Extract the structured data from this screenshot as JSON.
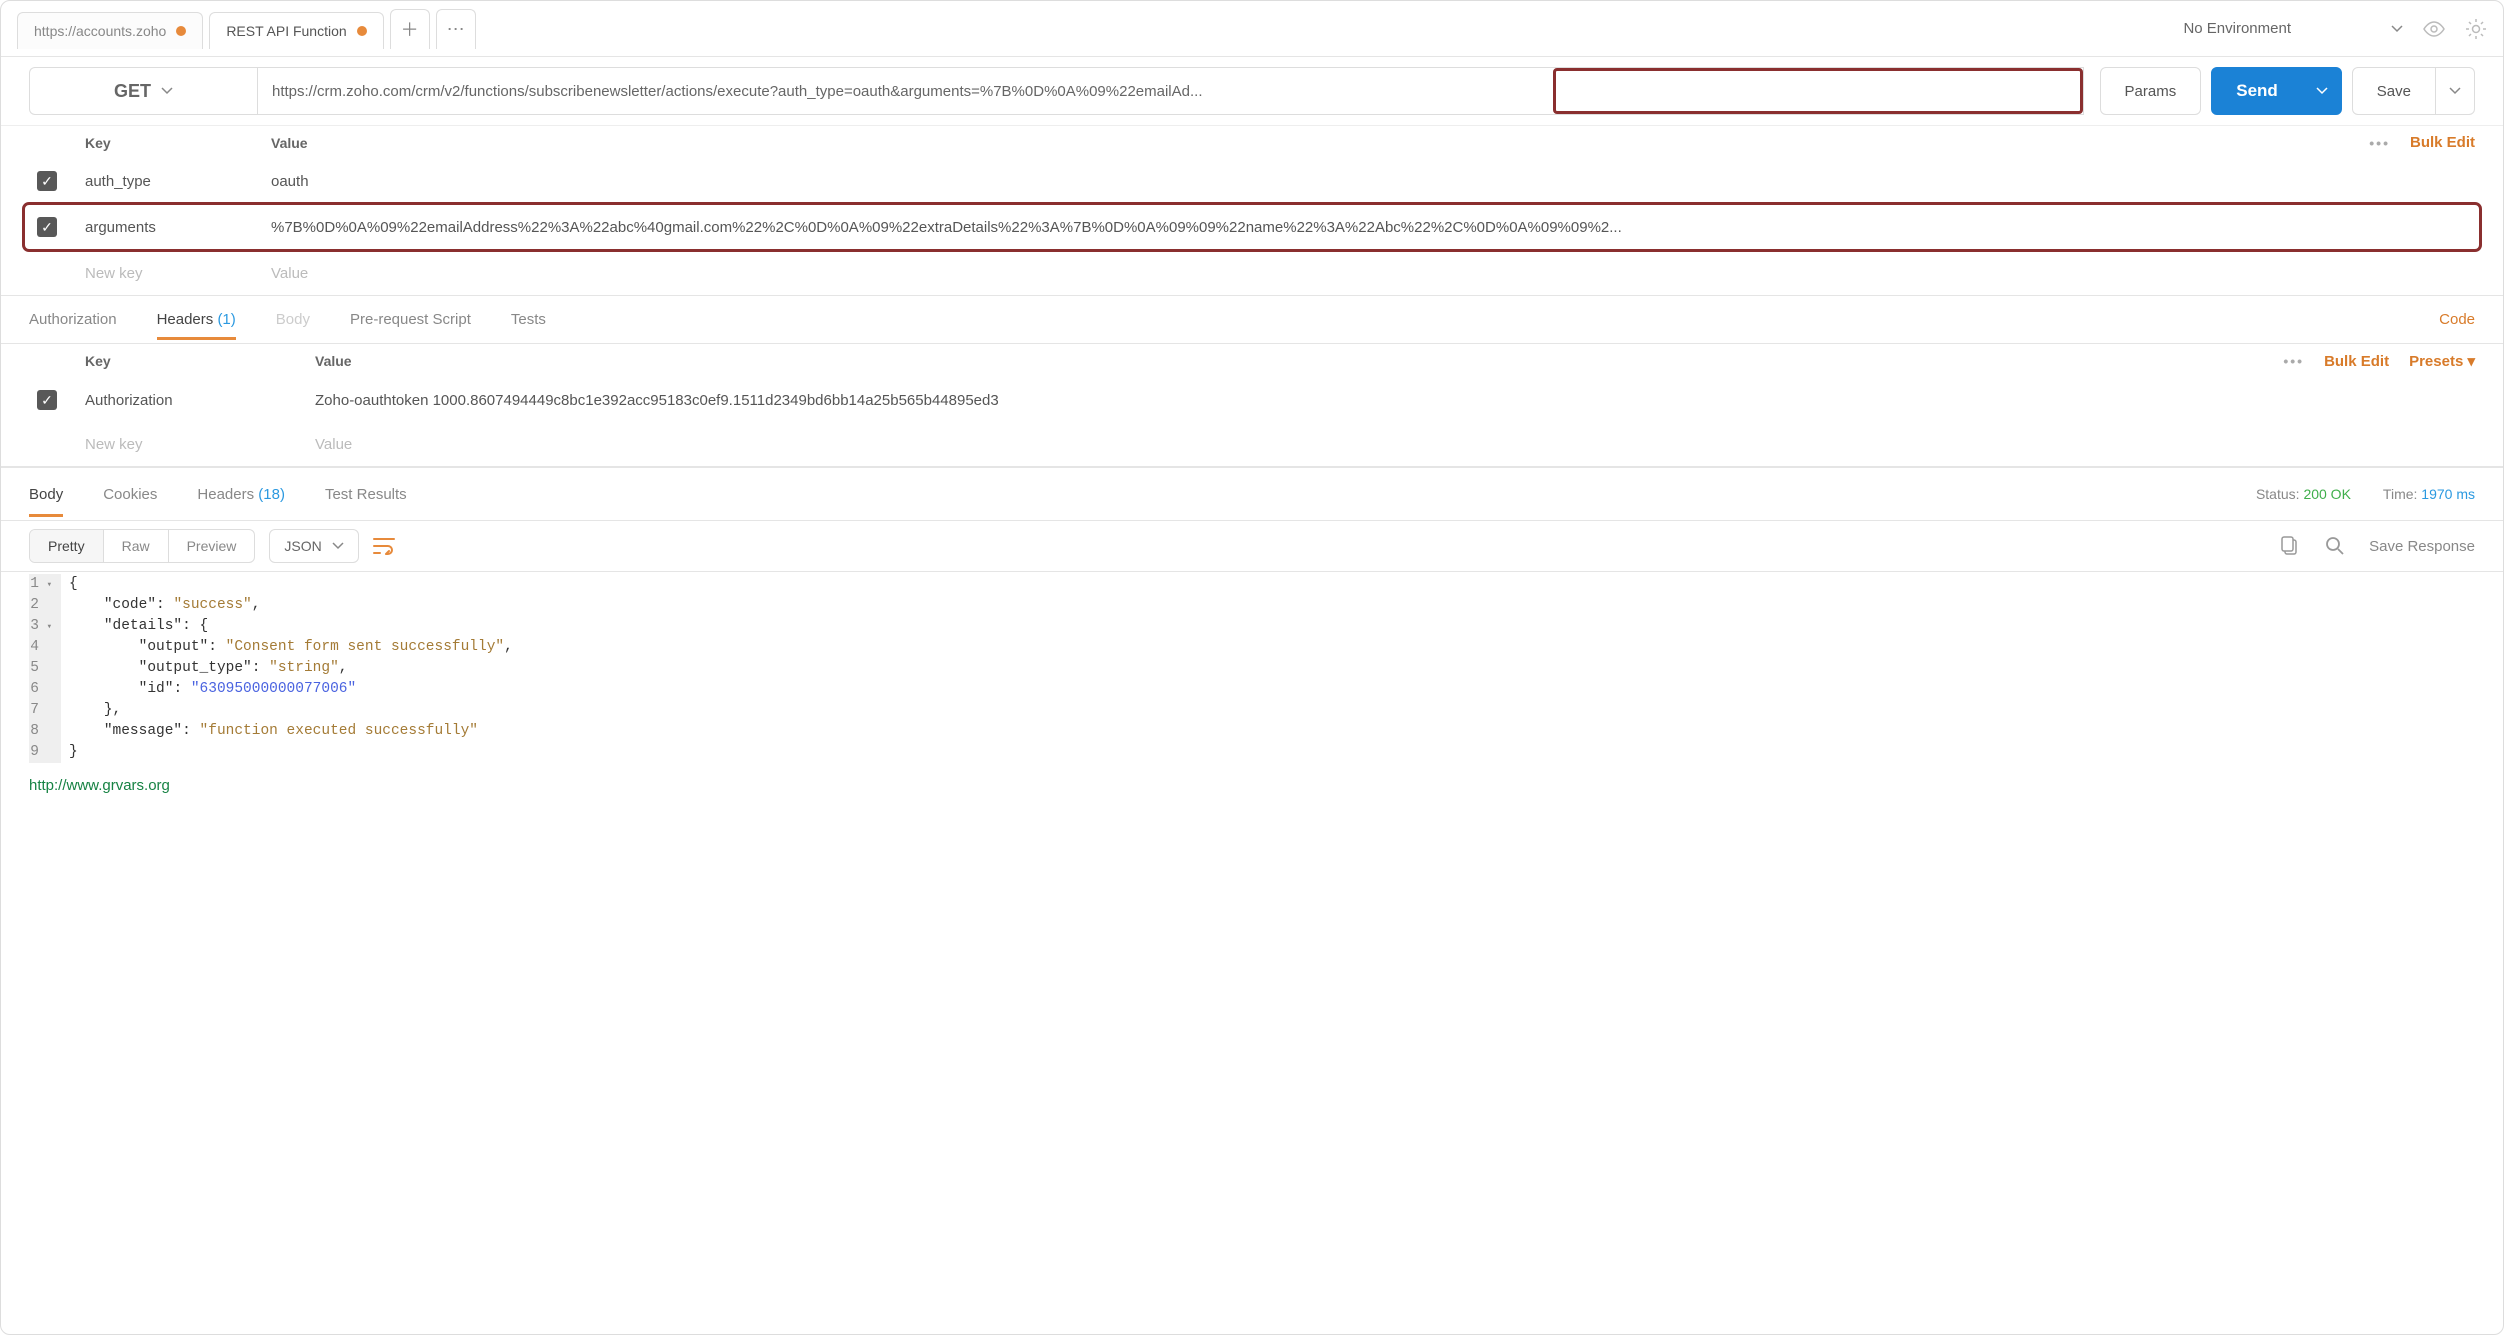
{
  "topbar": {
    "tabs": [
      {
        "label": "https://accounts.zoho",
        "dirty": true,
        "active": false
      },
      {
        "label": "REST API Function",
        "dirty": true,
        "active": true
      }
    ],
    "environment": "No Environment"
  },
  "request": {
    "method": "GET",
    "url": "https://crm.zoho.com/crm/v2/functions/subscribenewsletter/actions/execute?auth_type=oauth&arguments=%7B%0D%0A%09%22emailAd...",
    "params_btn": "Params",
    "send_btn": "Send",
    "save_btn": "Save"
  },
  "params_table": {
    "head_key": "Key",
    "head_value": "Value",
    "bulk_edit": "Bulk Edit",
    "rows": [
      {
        "checked": true,
        "key": "auth_type",
        "value": "oauth",
        "highlight": false
      },
      {
        "checked": true,
        "key": "arguments",
        "value": "%7B%0D%0A%09%22emailAddress%22%3A%22abc%40gmail.com%22%2C%0D%0A%09%22extraDetails%22%3A%7B%0D%0A%09%09%22name%22%3A%22Abc%22%2C%0D%0A%09%09%2...",
        "highlight": true
      }
    ],
    "placeholder_key": "New key",
    "placeholder_value": "Value"
  },
  "req_tabs": {
    "authorization": "Authorization",
    "headers": "Headers",
    "headers_count": "(1)",
    "body": "Body",
    "prerequest": "Pre-request Script",
    "tests": "Tests",
    "code": "Code"
  },
  "headers_table": {
    "head_key": "Key",
    "head_value": "Value",
    "bulk_edit": "Bulk Edit",
    "presets": "Presets",
    "rows": [
      {
        "checked": true,
        "key": "Authorization",
        "value": "Zoho-oauthtoken 1000.8607494449c8bc1e392acc95183c0ef9.1511d2349bd6bb14a25b565b44895ed3"
      }
    ],
    "placeholder_key": "New key",
    "placeholder_value": "Value"
  },
  "resp_tabs": {
    "body": "Body",
    "cookies": "Cookies",
    "headers": "Headers",
    "headers_count": "(18)",
    "test_results": "Test Results"
  },
  "status": {
    "status_label": "Status:",
    "status_value": "200 OK",
    "time_label": "Time:",
    "time_value": "1970 ms"
  },
  "viewbar": {
    "pretty": "Pretty",
    "raw": "Raw",
    "preview": "Preview",
    "format": "JSON",
    "save_response": "Save Response"
  },
  "response_json": {
    "l1": "{",
    "l2a": "\"code\"",
    "l2b": "\"success\"",
    "l3a": "\"details\"",
    "l4a": "\"output\"",
    "l4b": "\"Consent form sent successfully\"",
    "l5a": "\"output_type\"",
    "l5b": "\"string\"",
    "l6a": "\"id\"",
    "l6b": "\"63095000000077006\"",
    "l7": "},",
    "l8a": "\"message\"",
    "l8b": "\"function executed successfully\"",
    "l9": "}"
  },
  "footer_link": "http://www.grvars.org"
}
